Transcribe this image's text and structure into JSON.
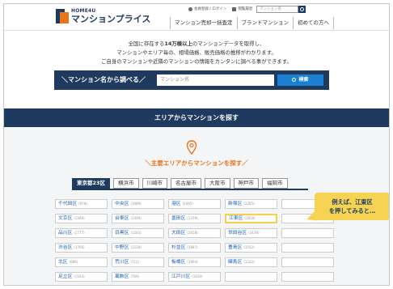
{
  "header": {
    "logo_small": "HOME4U",
    "logo_title": "マンションプライス",
    "util_links": [
      "会員登録 / ログイン",
      "閲覧履歴"
    ],
    "search_placeholder": "マンション名",
    "nav": [
      "マンション売却一括査定",
      "ブランドマンション",
      "初めての方へ"
    ]
  },
  "intro": {
    "line1_pre": "全国に存在する",
    "line1_bold": "14万棟以上",
    "line1_post": "のマンションデータを取得し、",
    "line2": "マンションやエリア毎の、相場価格、販売価格の推移がわかります。",
    "line3": "ご自身のマンションや近隣のマンションの情報をカンタンに調べる事ができます。"
  },
  "search": {
    "label": "＼マンション名から調べる／",
    "placeholder": "マンション名",
    "button": "検索"
  },
  "area": {
    "band_title": "エリアからマンションを探す",
    "subtitle": "＼主要エリアからマンションを探す／",
    "tabs": [
      "東京都23区",
      "横浜市",
      "川崎市",
      "名古屋市",
      "大阪市",
      "神戸市",
      "福岡市"
    ],
    "wards": [
      {
        "name": "千代田区",
        "count": "(978)"
      },
      {
        "name": "中央区",
        "count": "(1089)"
      },
      {
        "name": "港区",
        "count": "(2465)"
      },
      {
        "name": "新宿区",
        "count": "(2285)"
      },
      {
        "name": "",
        "count": ""
      },
      {
        "name": "文京区",
        "count": "(1448)"
      },
      {
        "name": "台東区",
        "count": "(1449)"
      },
      {
        "name": "墨田区",
        "count": "(1379)"
      },
      {
        "name": "江東区",
        "count": "(1816)"
      },
      {
        "name": "",
        "count": ""
      },
      {
        "name": "品川区",
        "count": "(1777)"
      },
      {
        "name": "目黒区",
        "count": "(1203)"
      },
      {
        "name": "大田区",
        "count": "(2658)"
      },
      {
        "name": "世田谷区",
        "count": "(3479)"
      },
      {
        "name": "",
        "count": ""
      },
      {
        "name": "渋谷区",
        "count": "(1766)"
      },
      {
        "name": "中野区",
        "count": "(1228)"
      },
      {
        "name": "杉並区",
        "count": "(1887)"
      },
      {
        "name": "豊島区",
        "count": "(1552)"
      },
      {
        "name": "",
        "count": ""
      },
      {
        "name": "北区",
        "count": "(886)"
      },
      {
        "name": "荒川区",
        "count": "(712)"
      },
      {
        "name": "板橋区",
        "count": "(1964)"
      },
      {
        "name": "練馬区",
        "count": "(1322)"
      },
      {
        "name": "",
        "count": ""
      },
      {
        "name": "足立区",
        "count": "(1193)"
      },
      {
        "name": "葛飾区",
        "count": "(769)"
      },
      {
        "name": "江戸川区",
        "count": "(1629)"
      },
      {
        "name": "",
        "count": ""
      },
      {
        "name": "",
        "count": ""
      }
    ]
  },
  "callout": {
    "line1": "例えば、江東区",
    "line2": "を押してみると…"
  },
  "colors": {
    "navy": "#1e3a5f",
    "orange": "#e8741c",
    "search_button": "#1d7fd1",
    "callout": "#f6d353",
    "link": "#1a5fb4"
  }
}
